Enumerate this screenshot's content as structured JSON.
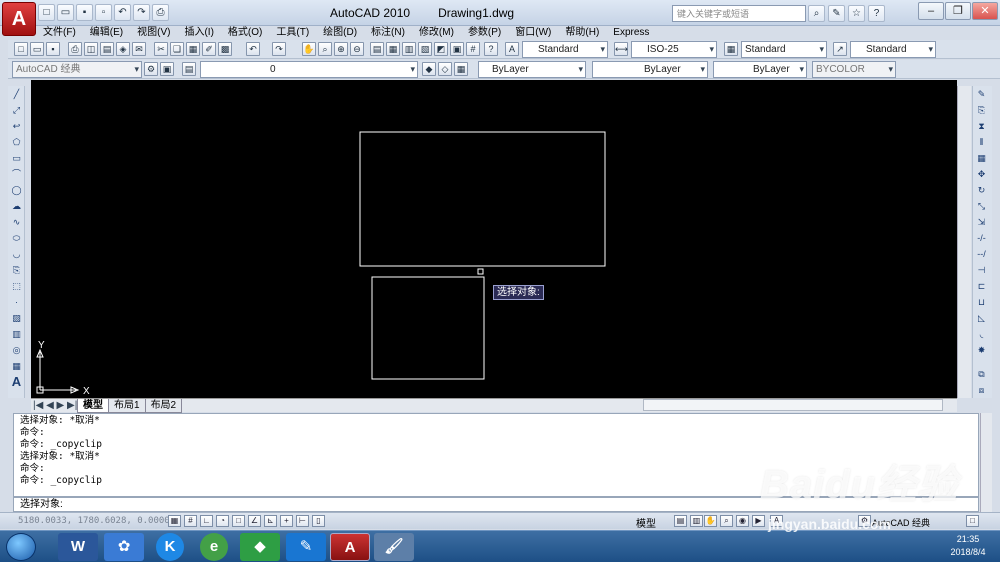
{
  "window": {
    "app_title": "AutoCAD 2010",
    "doc_title": "Drawing1.dwg",
    "search_placeholder": "键入关键字或短语",
    "app_letter": "A"
  },
  "menu": [
    "文件(F)",
    "编辑(E)",
    "视图(V)",
    "插入(I)",
    "格式(O)",
    "工具(T)",
    "绘图(D)",
    "标注(N)",
    "修改(M)",
    "参数(P)",
    "窗口(W)",
    "帮助(H)",
    "Express"
  ],
  "styles": {
    "text_style": "Standard",
    "dim_style": "ISO-25",
    "table_style": "Standard",
    "mleader_style": "Standard"
  },
  "workspace": "AutoCAD 经典",
  "layer": "0",
  "props": {
    "color": "ByLayer",
    "linetype": "ByLayer",
    "lineweight": "ByLayer",
    "plotstyle": "BYCOLOR"
  },
  "canvas": {
    "tooltip": "选择对象:",
    "axis_x": "X",
    "axis_y": "Y"
  },
  "layout_tabs": [
    "模型",
    "布局1",
    "布局2"
  ],
  "command_history": [
    "选择对象: *取消*",
    "命令:",
    "命令:  _copyclip",
    "选择对象: *取消*",
    "命令:",
    "命令: _copyclip"
  ],
  "command_prompt": "选择对象:",
  "status": {
    "coords": "5180.0033, 1780.6028, 0.0000",
    "model": "模型",
    "workspace": "AutoCAD 经典"
  },
  "taskbar": {
    "time": "21:35",
    "date": "2018/8/4"
  },
  "watermark": {
    "text": "Baidu经验",
    "url": "jingyan.baidu.com"
  },
  "colors": {
    "canvas": "#000000",
    "lines": "#ffffff",
    "tooltip_bg": "#2b2b55",
    "titlebar": "#c5d3e6",
    "taskbar": "#1d4f86"
  }
}
